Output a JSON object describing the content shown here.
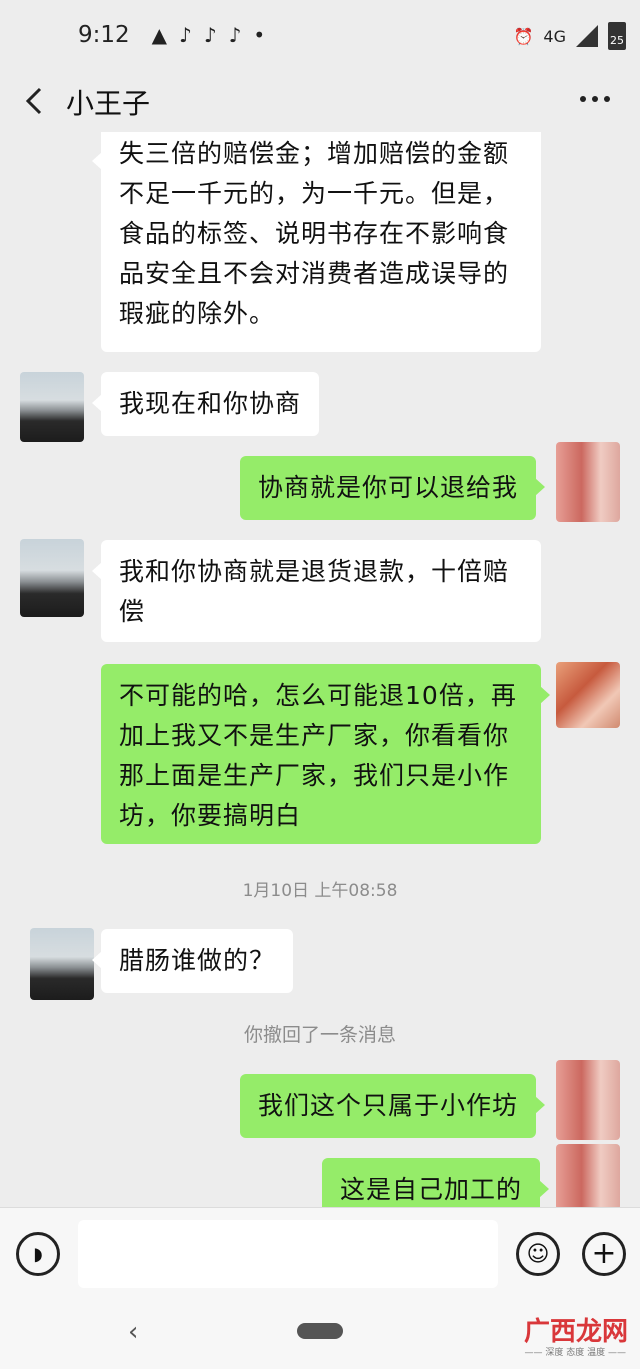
{
  "status": {
    "time": "9:12",
    "left_icons": [
      "▲",
      "♪",
      "♪",
      "♪",
      "•"
    ],
    "network": "4G",
    "battery": "25"
  },
  "header": {
    "title": "小王子"
  },
  "messages": [
    {
      "side": "in",
      "lines": [
        "失三倍的赔偿金；增加赔偿的金额",
        "不足一千元的，为一千元。但是，",
        "食品的标签、说明书存在不影响食",
        "品安全且不会对消费者造成误导的",
        "瑕疵的除外。"
      ]
    },
    {
      "side": "in",
      "lines": [
        "我现在和你协商"
      ]
    },
    {
      "side": "out",
      "lines": [
        "协商就是你可以退给我"
      ]
    },
    {
      "side": "in",
      "lines": [
        "我和你协商就是退货退款，十倍赔",
        "偿"
      ]
    },
    {
      "side": "out",
      "lines": [
        "不可能的哈，怎么可能退10倍，再",
        "加上我又不是生产厂家，你看看你",
        "那上面是生产厂家，我们只是小作",
        "坊，你要搞明白"
      ]
    },
    {
      "side": "in",
      "lines": [
        "腊肠谁做的？"
      ]
    },
    {
      "side": "out",
      "lines": [
        "我们这个只属于小作坊"
      ]
    },
    {
      "side": "out",
      "lines": [
        "这是自己加工的"
      ]
    }
  ],
  "timestamp": "1月10日 上午08:58",
  "system_note": "你撤回了一条消息",
  "watermark": {
    "main": "广西龙网",
    "sub": "—— 深度 态度 温度 ——"
  }
}
